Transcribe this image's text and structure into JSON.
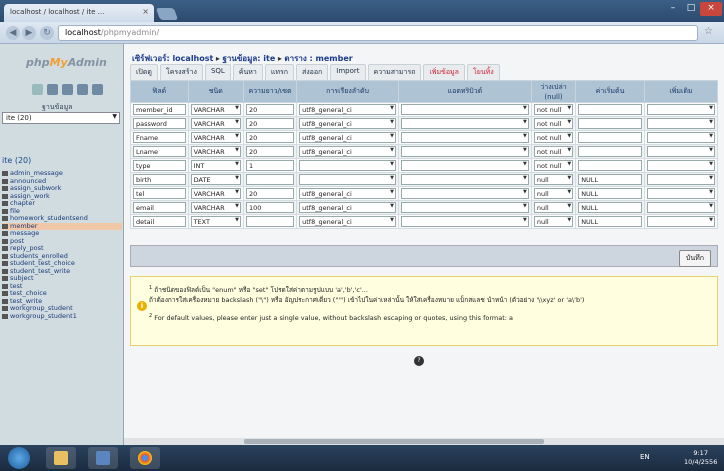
{
  "browser": {
    "tab_title": "localhost / localhost / ite ...",
    "address_host": "localhost",
    "address_path": "/phpmyadmin/"
  },
  "sidebar": {
    "logo_php": "php",
    "logo_my": "My",
    "logo_admin": "Admin",
    "db_label": "ฐานข้อมูล",
    "db_select": "ite (20)",
    "db_title": "ite (20)",
    "tables": [
      "admin_message",
      "announced",
      "assign_subwork",
      "assign_work",
      "chapter",
      "file",
      "homework_studentsend",
      "member",
      "message",
      "post",
      "reply_post",
      "students_enrolled",
      "student_test_choice",
      "student_test_write",
      "subject",
      "test",
      "test_choice",
      "test_write",
      "workgroup_student",
      "workgroup_student1"
    ],
    "active_table": "member"
  },
  "breadcrumb": {
    "server_label": "เซิร์ฟเวอร์: localhost",
    "db_label": "ฐานข้อมูล: ite",
    "table_label": "ตาราง : member"
  },
  "tabs": [
    "เปิดดู",
    "โครงสร้าง",
    "SQL",
    "ค้นหา",
    "แทรก",
    "ส่งออก",
    "Import",
    "ความสามารถ",
    "เพิ่มข้อมูล",
    "โยนทิ้ง"
  ],
  "grid": {
    "headers": [
      "ฟิลด์",
      "ชนิด",
      "ความยาว/เซต",
      "การเรียงลำดับ",
      "แอตทริบิวต์",
      "ว่างเปล่า (null)",
      "ค่าเริ่มต้น",
      "เพิ่มเติม"
    ],
    "rows": [
      {
        "field": "member_id",
        "type": "VARCHAR",
        "length": "20",
        "collation": "utf8_general_ci",
        "null": "not null",
        "default": ""
      },
      {
        "field": "password",
        "type": "VARCHAR",
        "length": "20",
        "collation": "utf8_general_ci",
        "null": "not null",
        "default": ""
      },
      {
        "field": "Fname",
        "type": "VARCHAR",
        "length": "20",
        "collation": "utf8_general_ci",
        "null": "not null",
        "default": ""
      },
      {
        "field": "Lname",
        "type": "VARCHAR",
        "length": "20",
        "collation": "utf8_general_ci",
        "null": "not null",
        "default": ""
      },
      {
        "field": "type",
        "type": "INT",
        "length": "1",
        "collation": "",
        "null": "not null",
        "default": ""
      },
      {
        "field": "birth",
        "type": "DATE",
        "length": "",
        "collation": "",
        "null": "null",
        "default": "NULL"
      },
      {
        "field": "tel",
        "type": "VARCHAR",
        "length": "20",
        "collation": "utf8_general_ci",
        "null": "null",
        "default": "NULL"
      },
      {
        "field": "email",
        "type": "VARCHAR",
        "length": "100",
        "collation": "utf8_general_ci",
        "null": "null",
        "default": "NULL"
      },
      {
        "field": "detail",
        "type": "TEXT",
        "length": "",
        "collation": "utf8_general_ci",
        "null": "null",
        "default": "NULL"
      }
    ]
  },
  "save_label": "บันทึก",
  "notes": {
    "note1_line1": "ถ้าชนิดของฟิลด์เป็น \"enum\" หรือ \"set\" โปรดใส่ค่าตามรูปแบบ 'a','b','c'...",
    "note1_line2": "ถ้าต้องการใส่เครื่องหมาย backslash (\"\\\") หรือ อัญประกาศเดี่ยว (\"'\") เข้าไปในค่าเหล่านั้น ให้ใส่เครื่องหมาย แบ็กสแลช นำหน้า (ตัวอย่าง '\\\\xyz' or 'a\\'b')",
    "note2": "For default values, please enter just a single value, without backslash escaping or quotes, using this format: a"
  },
  "taskbar": {
    "lang": "EN",
    "time": "9:17",
    "date": "10/4/2556"
  }
}
